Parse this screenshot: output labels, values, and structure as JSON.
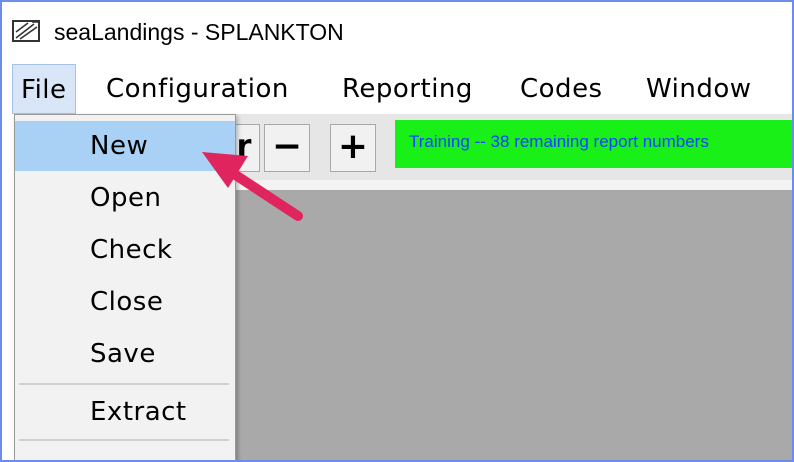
{
  "window": {
    "title": "seaLandings - SPLANKTON",
    "icon": "sealandings-app-icon"
  },
  "menubar": {
    "items": [
      {
        "label": "File",
        "active": true
      },
      {
        "label": "Configuration"
      },
      {
        "label": "Reporting"
      },
      {
        "label": "Codes"
      },
      {
        "label": "Window"
      }
    ]
  },
  "toolbar": {
    "dropdown_fragment": "r",
    "minus_label": "−",
    "plus_label": "+",
    "status_text": "Training -- 38 remaining report numbers",
    "status_bg_color": "#18f018",
    "status_text_color": "#1144ff"
  },
  "file_menu": {
    "items": [
      {
        "label": "New",
        "highlighted": true
      },
      {
        "label": "Open"
      },
      {
        "label": "Check"
      },
      {
        "label": "Close"
      },
      {
        "label": "Save"
      },
      {
        "label": "Extract"
      }
    ],
    "highlight_color": "#a9d0f5"
  },
  "annotation": {
    "arrow_color": "#e0245e",
    "points_to": "New"
  }
}
